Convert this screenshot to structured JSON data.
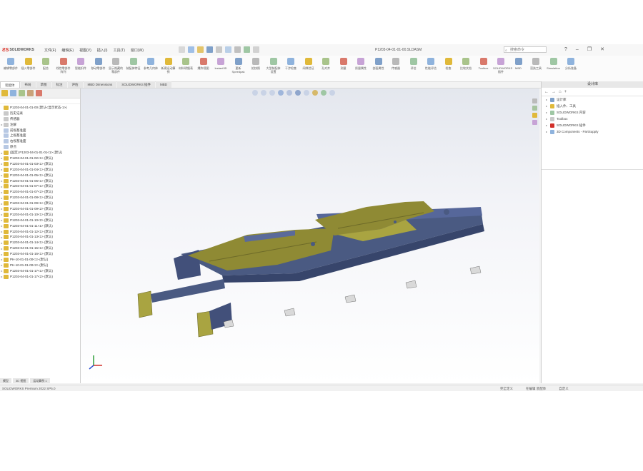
{
  "app": {
    "title": "P1203-04-01-01-00.SLDASM",
    "menus": [
      "文件(F)",
      "编辑(E)",
      "视图(V)",
      "插入(I)",
      "工具(T)",
      "窗口(W)"
    ],
    "search_placeholder": "搜索命令",
    "window_controls": [
      "?",
      "–",
      "❐",
      "✕"
    ]
  },
  "command_manager": {
    "items": [
      "编辑零部件",
      "插入零部件",
      "配合",
      "线性零部件阵列",
      "智能扣件",
      "移动零部件",
      "显示隐藏的零部件",
      "装配体特征",
      "参考几何体",
      "新建运动算例",
      "材料明细表",
      "爆炸视图",
      "Instant3D",
      "更新Speedpak",
      "拍快照",
      "大型装配体设置",
      "干涉检查",
      "间隙验证",
      "孔对齐",
      "测量",
      "质量属性",
      "剖面属性",
      "传感器",
      "评估",
      "性能评估",
      "检查",
      "比较文档",
      "Toolbox",
      "SOLIDWORKS插件",
      "MBD",
      "渲染工具",
      "Simulation",
      "分析准备"
    ]
  },
  "tabs": [
    "装配体",
    "布局",
    "草图",
    "标注",
    "评估",
    "MBD Dimensions",
    "SOLIDWORKS 插件",
    "MBD"
  ],
  "active_tab": "装配体",
  "feature_tree": {
    "root": "P1203-04-01-01-00 (默认<显示状态-1>)",
    "items": [
      "历史记录",
      "传感器",
      "注解",
      "前视基准面",
      "上视基准面",
      "右视基准面",
      "原点",
      "(固定) P1203-04-01-01-01<1> (默认)",
      "P1203-04-01-01-02<1> (默认)",
      "P1203-04-01-01-03<1> (默认)",
      "P1203-04-01-01-04<1> (默认)",
      "P1203-04-01-01-05<1> (默认)",
      "P1203-04-01-01-06<1> (默认)",
      "P1203-04-01-01-07<1> (默认)",
      "P1203-04-01-01-07<2> (默认)",
      "P1203-04-01-01-08<1> (默认)",
      "P1203-04-01-01-09<1> (默认)",
      "P1203-04-01-01-09<2> (默认)",
      "P1203-04-01-01-10<1> (默认)",
      "P1203-04-01-01-10<2> (默认)",
      "P1203-04-01-01-11<1> (默认)",
      "P1203-04-01-01-12<1> (默认)",
      "P1203-04-01-01-13<1> (默认)",
      "P1203-04-01-01-14<1> (默认)",
      "P1203-04-01-01-15<1> (默认)",
      "P1203-04-01-01-16<1> (默认)",
      "PH-10-01-01-00<1> (默认)",
      "PH-10-01-01-00<2> (默认)",
      "P1203-04-01-01-17<1> (默认)",
      "P1203-04-01-01-17<2> (默认)"
    ]
  },
  "task_pane": {
    "title": "设计库",
    "items": [
      "设计库",
      "插入件、工具",
      "SOLIDWORKS 内容",
      "Toolbox",
      "SOLIDWORKS 插件",
      "3D Components - PartSupply"
    ]
  },
  "bottom_tabs": [
    "模型",
    "3D 视图",
    "运动算例 1"
  ],
  "status": {
    "left": "SOLIDWORKS Premium 2022 SP5.0",
    "right": [
      "完全定义",
      "在编辑 装配体",
      "自定义"
    ]
  },
  "colors": {
    "frame": "#4a5a82",
    "frame_dark": "#37456b",
    "plate": "#8f8a34",
    "plate_light": "#a9a441",
    "feature_icon": "#e0b93a",
    "accent": "#1f6fc5"
  }
}
